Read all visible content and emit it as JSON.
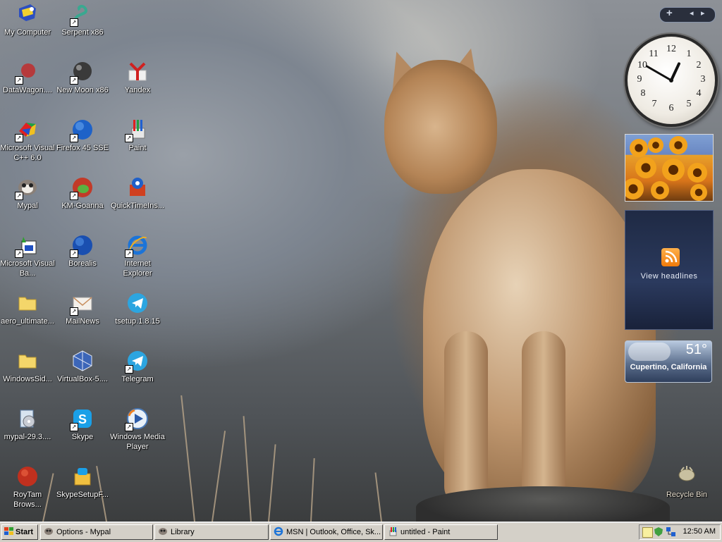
{
  "desktop": {
    "icons": [
      {
        "label": "My Computer",
        "icon": "my-computer-icon",
        "shortcut": false
      },
      {
        "label": "Serpent x86",
        "icon": "serpent-icon",
        "shortcut": true
      },
      {
        "label": "DataWagon....",
        "icon": "datawagon-icon",
        "shortcut": true
      },
      {
        "label": "New Moon x86",
        "icon": "new-moon-icon",
        "shortcut": true
      },
      {
        "label": "Yandex",
        "icon": "yandex-icon",
        "shortcut": false
      },
      {
        "label": "Microsoft Visual C++ 6.0",
        "icon": "visual-cpp-icon",
        "shortcut": true
      },
      {
        "label": "Firefox 45 SSE",
        "icon": "firefox-icon",
        "shortcut": true
      },
      {
        "label": "Paint",
        "icon": "paint-icon",
        "shortcut": true
      },
      {
        "label": "Mypal",
        "icon": "mypal-icon",
        "shortcut": true
      },
      {
        "label": "KM-Goanna",
        "icon": "km-goanna-icon",
        "shortcut": true
      },
      {
        "label": "QuickTimeIns...",
        "icon": "quicktime-installer-icon",
        "shortcut": false
      },
      {
        "label": "Microsoft Visual Ba...",
        "icon": "visual-basic-icon",
        "shortcut": true
      },
      {
        "label": "Borealis",
        "icon": "borealis-icon",
        "shortcut": true
      },
      {
        "label": "Internet Explorer",
        "icon": "internet-explorer-icon",
        "shortcut": true
      },
      {
        "label": "aero_ultimate...",
        "icon": "folder-icon",
        "shortcut": false
      },
      {
        "label": "MailNews",
        "icon": "mailnews-icon",
        "shortcut": true
      },
      {
        "label": "tsetup.1.8.15",
        "icon": "telegram-setup-icon",
        "shortcut": false
      },
      {
        "label": "WindowsSid...",
        "icon": "folder-icon",
        "shortcut": false
      },
      {
        "label": "VirtualBox-5....",
        "icon": "virtualbox-icon",
        "shortcut": false
      },
      {
        "label": "Telegram",
        "icon": "telegram-icon",
        "shortcut": true
      },
      {
        "label": "mypal-29.3....",
        "icon": "installer-icon",
        "shortcut": false
      },
      {
        "label": "Skype",
        "icon": "skype-icon",
        "shortcut": true
      },
      {
        "label": "Windows Media Player",
        "icon": "windows-media-player-icon",
        "shortcut": true
      },
      {
        "label": "RoyTam Brows...",
        "icon": "roytam-browser-icon",
        "shortcut": false
      },
      {
        "label": "SkypeSetupF...",
        "icon": "skype-setup-icon",
        "shortcut": false
      },
      {
        "label": "Recycle Bin",
        "icon": "recycle-bin-icon",
        "shortcut": false
      }
    ]
  },
  "sidebar": {
    "add_label": "+",
    "prev_label": "◂",
    "next_label": "▸",
    "clock": {
      "numbers": [
        "12",
        "1",
        "2",
        "3",
        "4",
        "5",
        "6",
        "7",
        "8",
        "9",
        "10",
        "11"
      ],
      "time": "12:50"
    },
    "feeds": {
      "label": "View headlines"
    },
    "weather": {
      "temperature": "51°",
      "location": "Cupertino, California"
    }
  },
  "taskbar": {
    "start_label": "Start",
    "tasks": [
      {
        "label": "Options - Mypal",
        "icon": "mypal-icon"
      },
      {
        "label": "Library",
        "icon": "mypal-icon"
      },
      {
        "label": "MSN | Outlook, Office, Sk...",
        "icon": "internet-explorer-icon"
      },
      {
        "label": "untitled - Paint",
        "icon": "paint-icon"
      }
    ],
    "clock": "12:50 AM"
  },
  "colors": {
    "taskbar_bg": "#d4d0c8",
    "sidebar_dark": "#1f2a44",
    "rss_orange": "#f07a0a"
  }
}
